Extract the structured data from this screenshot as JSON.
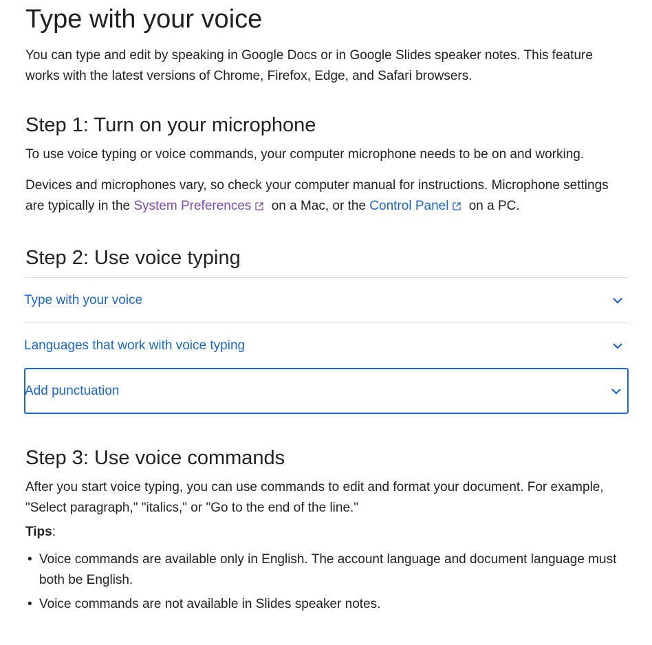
{
  "title": "Type with your voice",
  "intro": "You can type and edit by speaking in Google Docs or in Google Slides speaker notes. This feature works with the latest versions of Chrome, Firefox, Edge, and Safari browsers.",
  "step1": {
    "title": "Step 1: Turn on your microphone",
    "p1": "To use voice typing or voice commands, your computer microphone needs to be on and working.",
    "p2_before": "Devices and microphones vary, so check your computer manual for instructions. Microphone settings are typically in the ",
    "link1": "System Preferences",
    "p2_middle": " on a Mac, or the ",
    "link2": "Control Panel",
    "p2_after": " on a PC.",
    "link1_icon": "external-link-icon",
    "link2_icon": "external-link-icon"
  },
  "step2": {
    "title": "Step 2: Use voice typing",
    "items": [
      {
        "label": "Type with your voice",
        "icon": "chevron-down-icon"
      },
      {
        "label": "Languages that work with voice typing",
        "icon": "chevron-down-icon"
      },
      {
        "label": "Add punctuation",
        "icon": "chevron-down-icon"
      }
    ]
  },
  "step3": {
    "title": "Step 3: Use voice commands",
    "p1": "After you start voice typing, you can use commands to edit and format your document. For example, \"Select paragraph,\" \"italics,\" or \"Go to the end of the line.\"",
    "tips_label": "Tips",
    "tips_colon": ":",
    "bullet": "•",
    "tips": [
      "Voice commands are available only in English. The account language and document language must both be English.",
      "Voice commands are not available in Slides speaker notes."
    ]
  },
  "colors": {
    "link": "#1a67d2",
    "visited_link": "#7c4dab",
    "text": "#202124",
    "divider": "#dadce0"
  }
}
